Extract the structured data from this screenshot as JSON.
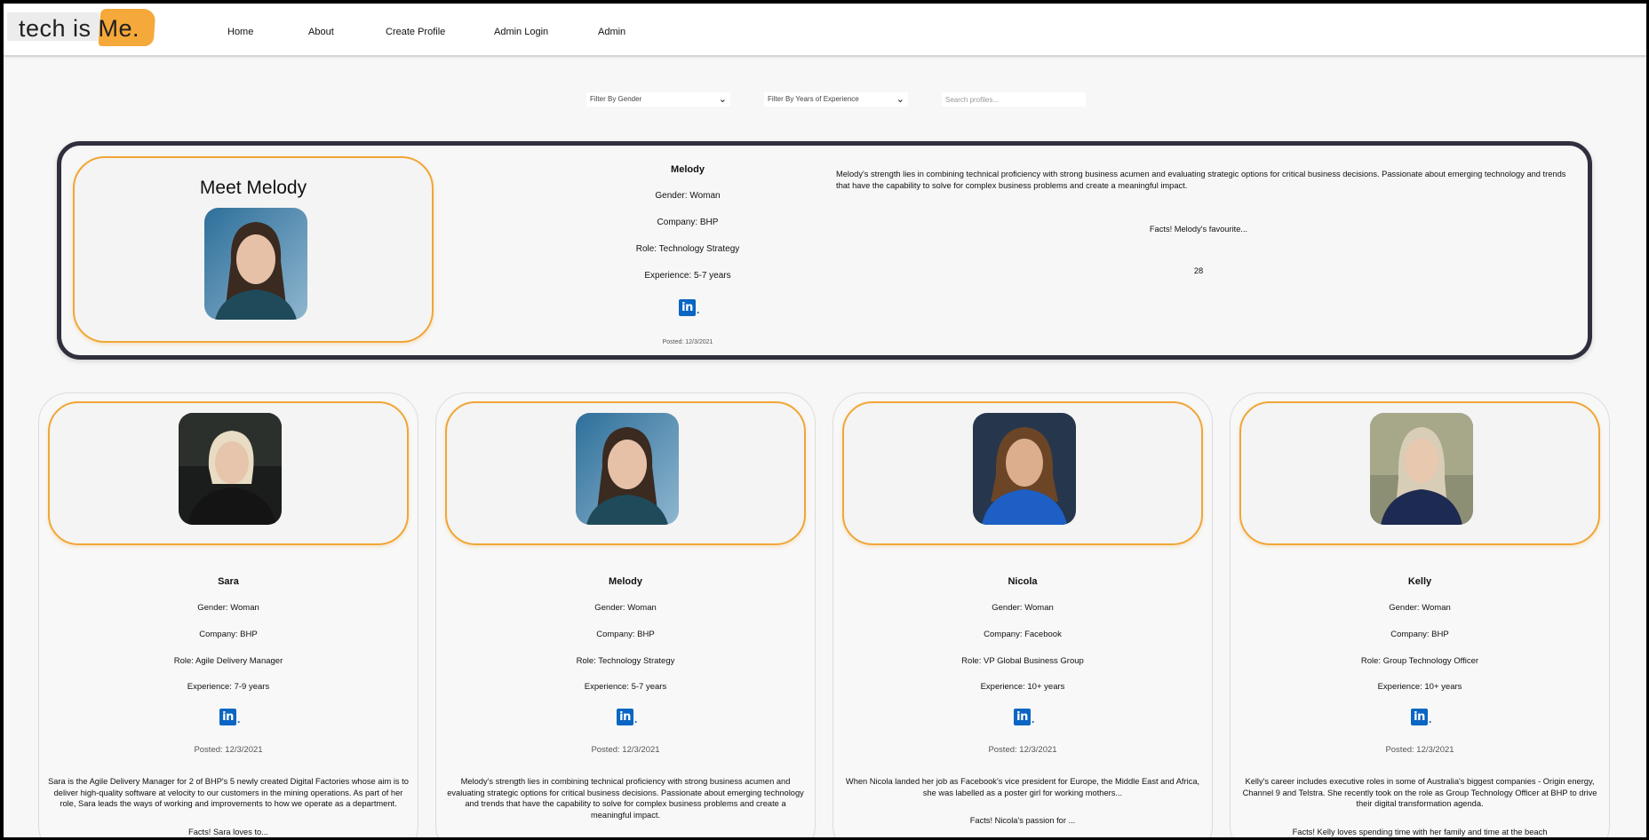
{
  "logo": {
    "part1": "tech is",
    "part2": "Me."
  },
  "nav": [
    "Home",
    "About",
    "Create Profile",
    "Admin Login",
    "Admin"
  ],
  "filters": {
    "gender": "Filter By Gender",
    "experience": "Filter By Years of Experience",
    "search_placeholder": "Search profiles..."
  },
  "featured": {
    "title": "Meet Melody",
    "name": "Melody",
    "gender": "Gender: Woman",
    "company": "Company: BHP",
    "role": "Role: Technology Strategy",
    "experience": "Experience: 5-7 years",
    "posted": "Posted: 12/3/2021",
    "description": "Melody's strength lies in combining technical proficiency with strong business acumen and evaluating strategic options for critical business decisions. Passionate about emerging technology and trends that have the capability to solve for complex business problems and create a meaningful impact.",
    "facts": "Facts! Melody's favourite...",
    "number": "28"
  },
  "cards": [
    {
      "name": "Sara",
      "gender": "Gender: Woman",
      "company": "Company: BHP",
      "role": "Role: Agile Delivery Manager",
      "experience": "Experience: 7-9 years",
      "posted": "Posted: 12/3/2021",
      "description": "Sara is the Agile Delivery Manager for 2 of BHP's 5 newly created Digital Factories whose aim is to deliver high-quality software at velocity to our customers in the mining operations. As part of her role, Sara leads the ways of working and improvements to how we operate as a department.",
      "facts": "Facts! Sara loves to..."
    },
    {
      "name": "Melody",
      "gender": "Gender: Woman",
      "company": "Company: BHP",
      "role": "Role: Technology Strategy",
      "experience": "Experience: 5-7 years",
      "posted": "Posted: 12/3/2021",
      "description": "Melody's strength lies in combining technical proficiency with strong business acumen and evaluating strategic options for critical business decisions. Passionate about emerging technology and trends that have the capability to solve for complex business problems and create a meaningful impact.",
      "facts": ""
    },
    {
      "name": "Nicola",
      "gender": "Gender: Woman",
      "company": "Company: Facebook",
      "role": "Role: VP Global Business Group",
      "experience": "Experience: 10+ years",
      "posted": "Posted: 12/3/2021",
      "description": "When Nicola landed her job as Facebook's vice president for Europe, the Middle East and Africa, she was labelled as a poster girl for working mothers...",
      "facts": "Facts! Nicola's passion for ..."
    },
    {
      "name": "Kelly",
      "gender": "Gender: Woman",
      "company": "Company: BHP",
      "role": "Role: Group Technology Officer",
      "experience": "Experience: 10+ years",
      "posted": "Posted: 12/3/2021",
      "description": "Kelly's career includes executive roles in some of Australia's biggest companies - Origin energy, Channel 9 and Telstra. She recently took on the role as Group Technology Officer at BHP to drive their digital transformation agenda.",
      "facts": "Facts! Kelly loves spending time with her family and time at the beach"
    }
  ],
  "colors": {
    "accent": "#f0a636",
    "featured_border": "#2f2f3d",
    "linkedin": "#0a66c2"
  },
  "icons": {
    "linkedin": "linkedin-icon",
    "dropdown": "chevron-down-icon"
  }
}
